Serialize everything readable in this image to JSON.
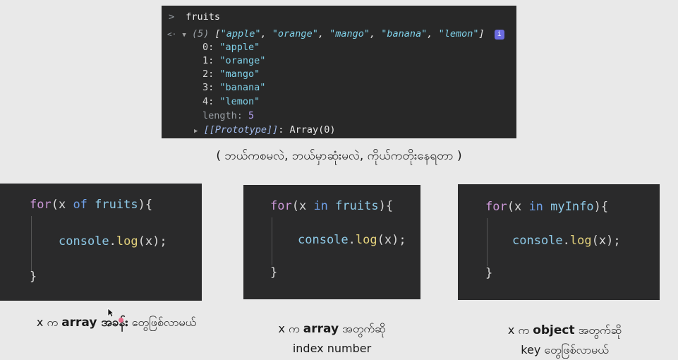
{
  "console": {
    "input_prompt": ">",
    "input_text": "fruits",
    "result_prompt": "<·",
    "summary_count": "(5)",
    "summary_items": [
      "\"apple\"",
      "\"orange\"",
      "\"mango\"",
      "\"banana\"",
      "\"lemon\""
    ],
    "info_label": "i",
    "entries": [
      {
        "key": "0:",
        "value": "\"apple\""
      },
      {
        "key": "1:",
        "value": "\"orange\""
      },
      {
        "key": "2:",
        "value": "\"mango\""
      },
      {
        "key": "3:",
        "value": "\"banana\""
      },
      {
        "key": "4:",
        "value": "\"lemon\""
      }
    ],
    "length_key": "length:",
    "length_value": "5",
    "prototype_key": "[[Prototype]]",
    "prototype_value": ": Array(0)"
  },
  "caption": "( ဘယ်ကစမလဲ, ဘယ်မှာဆုံးမလဲ, ကိုယ်ကတိုးနေရတာ )",
  "panels": [
    {
      "for_kw": "for",
      "open": "(x ",
      "op": "of",
      "target": " fruits",
      "close": "){",
      "call_obj": "console",
      "call_dot": ".",
      "call_fn": "log",
      "call_args": "(x);",
      "end": "}"
    },
    {
      "for_kw": "for",
      "open": "(x ",
      "op": "in",
      "target": " fruits",
      "close": "){",
      "call_obj": "console",
      "call_dot": ".",
      "call_fn": "log",
      "call_args": "(x);",
      "end": "}"
    },
    {
      "for_kw": "for",
      "open": "(x ",
      "op": "in",
      "target": " myInfo",
      "close": "){",
      "call_obj": "console",
      "call_dot": ".",
      "call_fn": "log",
      "call_args": "(x);",
      "end": "}"
    }
  ],
  "labels": [
    {
      "pre": "x က ",
      "bold": "array အခန်း",
      "post": " တွေဖြစ်လာမယ်",
      "line2": ""
    },
    {
      "pre": "x က ",
      "bold": "array",
      "post": " အတွက်ဆို",
      "line2": "index number"
    },
    {
      "pre": "x က ",
      "bold": "object",
      "post": " အတွက်ဆို",
      "line2": "key တွေဖြစ်လာမယ်"
    }
  ]
}
